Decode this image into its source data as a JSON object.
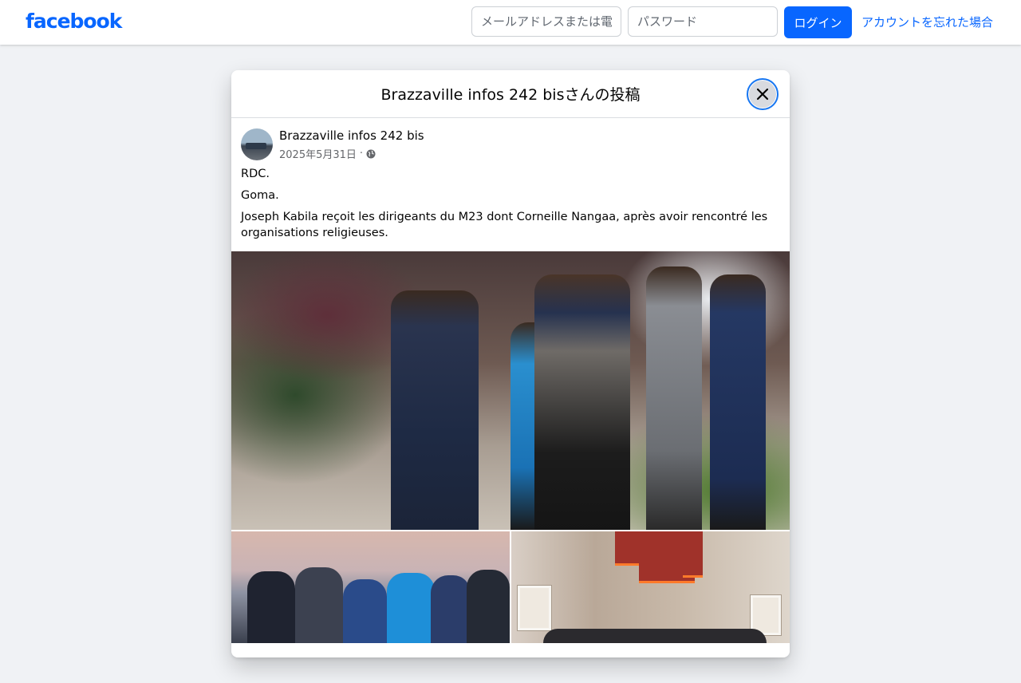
{
  "header": {
    "logo_text": "facebook",
    "email_placeholder": "メールアドレスまたは電話番号",
    "password_placeholder": "パスワード",
    "login_label": "ログイン",
    "forgot_label": "アカウントを忘れた場合"
  },
  "modal": {
    "title": "Brazzaville infos 242 bisさんの投稿",
    "close_icon": "close-icon"
  },
  "post": {
    "author": "Brazzaville infos 242 bis",
    "date": "2025年5月31日",
    "separator": "·",
    "audience_icon": "globe-icon",
    "lines": [
      "RDC.",
      "Goma.",
      "Joseph Kabila reçoit les dirigeants du M23 dont Corneille Nangaa, après avoir rencontré les organisations religieuses."
    ]
  },
  "colors": {
    "brand": "#0866ff",
    "page_background": "#f0f2f5",
    "secondary_text": "#65676b"
  }
}
